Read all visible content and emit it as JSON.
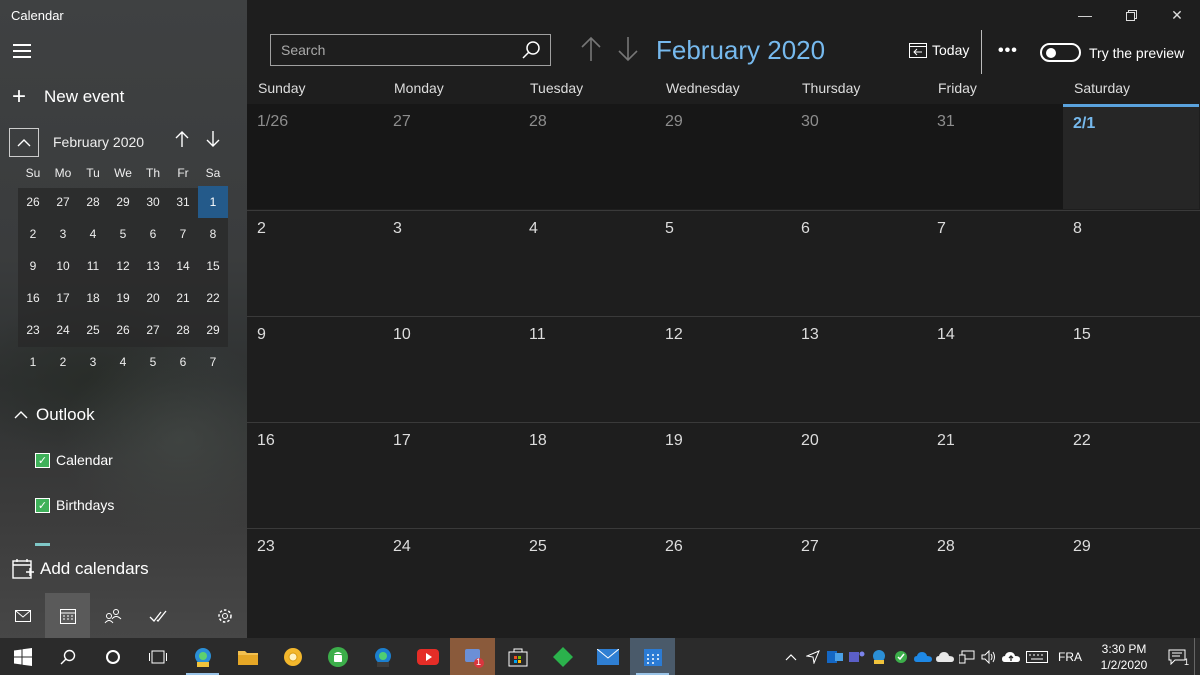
{
  "app": {
    "title": "Calendar"
  },
  "left": {
    "new_event": "New event",
    "mini": {
      "title": "February 2020",
      "dow": [
        "Su",
        "Mo",
        "Tu",
        "We",
        "Th",
        "Fr",
        "Sa"
      ],
      "weeks": [
        [
          "26",
          "27",
          "28",
          "29",
          "30",
          "31",
          "1"
        ],
        [
          "2",
          "3",
          "4",
          "5",
          "6",
          "7",
          "8"
        ],
        [
          "9",
          "10",
          "11",
          "12",
          "13",
          "14",
          "15"
        ],
        [
          "16",
          "17",
          "18",
          "19",
          "20",
          "21",
          "22"
        ],
        [
          "23",
          "24",
          "25",
          "26",
          "27",
          "28",
          "29"
        ],
        [
          "1",
          "2",
          "3",
          "4",
          "5",
          "6",
          "7"
        ]
      ],
      "selected": "1"
    },
    "group": "Outlook",
    "calendars": [
      "Calendar",
      "Birthdays"
    ],
    "add_calendars": "Add calendars"
  },
  "main": {
    "search_placeholder": "Search",
    "month_title": "February 2020",
    "today": "Today",
    "more": "•••",
    "preview": "Try the preview",
    "dow": [
      "Sunday",
      "Monday",
      "Tuesday",
      "Wednesday",
      "Thursday",
      "Friday",
      "Saturday"
    ],
    "weeks": [
      [
        "1/26",
        "27",
        "28",
        "29",
        "30",
        "31",
        "2/1"
      ],
      [
        "2",
        "3",
        "4",
        "5",
        "6",
        "7",
        "8"
      ],
      [
        "9",
        "10",
        "11",
        "12",
        "13",
        "14",
        "15"
      ],
      [
        "16",
        "17",
        "18",
        "19",
        "20",
        "21",
        "22"
      ],
      [
        "23",
        "24",
        "25",
        "26",
        "27",
        "28",
        "29"
      ]
    ]
  },
  "taskbar": {
    "time": "3:30 PM",
    "date": "1/2/2020",
    "language": "FRA",
    "badges": {
      "store": "1",
      "notifications": "1"
    }
  },
  "colors": {
    "accent": "#76b9ed",
    "selected": "#245a8a",
    "check": "#3fb15a"
  }
}
